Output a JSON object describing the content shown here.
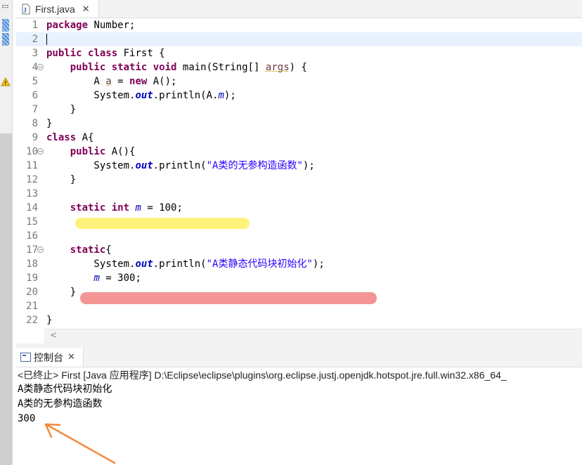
{
  "editor": {
    "tab_label": "First.java",
    "tab_close": "✕",
    "lines": [
      {
        "n": "1",
        "tokens": [
          {
            "t": "package",
            "c": "kw"
          },
          {
            "t": " Number;"
          }
        ]
      },
      {
        "n": "2",
        "tokens": []
      },
      {
        "n": "3",
        "tokens": [
          {
            "t": "public",
            "c": "kw"
          },
          {
            "t": " "
          },
          {
            "t": "class",
            "c": "kw"
          },
          {
            "t": " First {"
          }
        ]
      },
      {
        "n": "4",
        "fold": true,
        "tokens": [
          {
            "t": "    "
          },
          {
            "t": "public",
            "c": "kw"
          },
          {
            "t": " "
          },
          {
            "t": "static",
            "c": "kw"
          },
          {
            "t": " "
          },
          {
            "t": "void",
            "c": "kw"
          },
          {
            "t": " main(String[] "
          },
          {
            "t": "args",
            "c": "var"
          },
          {
            "t": ") {"
          }
        ]
      },
      {
        "n": "5",
        "warn": true,
        "tokens": [
          {
            "t": "        A "
          },
          {
            "t": "a",
            "c": "var"
          },
          {
            "t": " = "
          },
          {
            "t": "new",
            "c": "kw"
          },
          {
            "t": " A();"
          }
        ]
      },
      {
        "n": "6",
        "tokens": [
          {
            "t": "        System."
          },
          {
            "t": "out",
            "c": "sfld"
          },
          {
            "t": ".println(A."
          },
          {
            "t": "m",
            "c": "fld"
          },
          {
            "t": ");"
          }
        ]
      },
      {
        "n": "7",
        "tokens": [
          {
            "t": "    }"
          }
        ]
      },
      {
        "n": "8",
        "tokens": [
          {
            "t": "}"
          }
        ]
      },
      {
        "n": "9",
        "tokens": [
          {
            "t": "class",
            "c": "kw"
          },
          {
            "t": " A{"
          }
        ]
      },
      {
        "n": "10",
        "fold": true,
        "tokens": [
          {
            "t": "    "
          },
          {
            "t": "public",
            "c": "kw"
          },
          {
            "t": " A(){"
          }
        ]
      },
      {
        "n": "11",
        "tokens": [
          {
            "t": "        System."
          },
          {
            "t": "out",
            "c": "sfld"
          },
          {
            "t": ".println("
          },
          {
            "t": "\"A类的无参构造函数\"",
            "c": "str"
          },
          {
            "t": ");"
          }
        ]
      },
      {
        "n": "12",
        "tokens": [
          {
            "t": "    }"
          }
        ]
      },
      {
        "n": "13",
        "tokens": []
      },
      {
        "n": "14",
        "tokens": [
          {
            "t": "    "
          },
          {
            "t": "static",
            "c": "kw"
          },
          {
            "t": " "
          },
          {
            "t": "int",
            "c": "kw"
          },
          {
            "t": " "
          },
          {
            "t": "m",
            "c": "fld"
          },
          {
            "t": " = 100;"
          }
        ]
      },
      {
        "n": "15",
        "tokens": []
      },
      {
        "n": "16",
        "tokens": []
      },
      {
        "n": "17",
        "fold": true,
        "tokens": [
          {
            "t": "    "
          },
          {
            "t": "static",
            "c": "kw"
          },
          {
            "t": "{"
          }
        ]
      },
      {
        "n": "18",
        "tokens": [
          {
            "t": "        System."
          },
          {
            "t": "out",
            "c": "sfld"
          },
          {
            "t": ".println("
          },
          {
            "t": "\"A类静态代码块初始化\"",
            "c": "str"
          },
          {
            "t": ");"
          }
        ]
      },
      {
        "n": "19",
        "tokens": [
          {
            "t": "        "
          },
          {
            "t": "m",
            "c": "fld"
          },
          {
            "t": " = 300;"
          }
        ]
      },
      {
        "n": "20",
        "tokens": [
          {
            "t": "    }"
          }
        ]
      },
      {
        "n": "21",
        "tokens": []
      },
      {
        "n": "22",
        "tokens": [
          {
            "t": "}"
          }
        ]
      }
    ]
  },
  "console": {
    "tab_label": "控制台",
    "tab_close": "✕",
    "description": "<已终止> First [Java 应用程序] D:\\Eclipse\\eclipse\\plugins\\org.eclipse.justj.openjdk.hotspot.jre.full.win32.x86_64_",
    "output": [
      "A类静态代码块初始化",
      "A类的无参构造函数",
      "300"
    ]
  },
  "colors": {
    "keyword": "#7f0055",
    "string": "#2a00ff",
    "field": "#0000c0",
    "highlight_yellow": "#fff27a",
    "highlight_red": "#f28a8a",
    "arrow": "#f08a3c"
  }
}
